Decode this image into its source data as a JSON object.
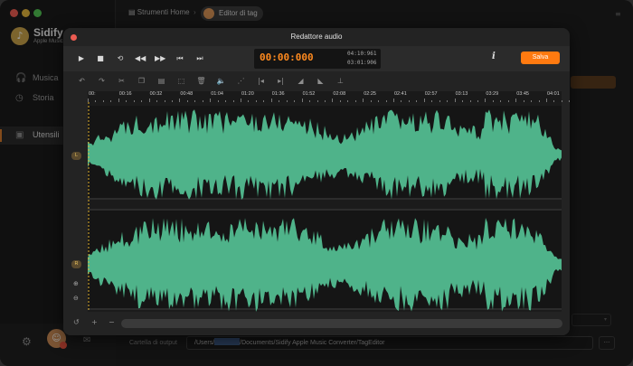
{
  "sidebar": {
    "brand_name": "Sidify",
    "brand_sub": "Apple Music Converter",
    "items": [
      {
        "label": "Musica",
        "icon": "headphones-icon"
      },
      {
        "label": "Storia",
        "icon": "clock-icon"
      },
      {
        "label": "Utensili",
        "icon": "toolbox-icon",
        "active": true
      }
    ]
  },
  "breadcrumb": {
    "home_label": "Strumenti Home",
    "current_label": "Editor di tag"
  },
  "output": {
    "label": "Cartella di output",
    "path_prefix": "/Users/",
    "path_suffix": "/Documents/Sidify Apple Music Converter/TagEditor",
    "more_label": "···"
  },
  "modal": {
    "title": "Redattore audio",
    "timecode": "00:00:000",
    "total_time": "04:10:961",
    "selection_time": "03:01:906",
    "save_label": "Salva",
    "info_label": "i"
  },
  "ruler_ticks": [
    "00:",
    "00:16",
    "00:32",
    "00:48",
    "01:04",
    "01:20",
    "01:36",
    "01:52",
    "02:08",
    "02:25",
    "02:41",
    "02:57",
    "03:13",
    "03:29",
    "03:45",
    "04:01"
  ],
  "channels": {
    "left": "L",
    "right": "R"
  },
  "colors": {
    "accent": "#ff7a10",
    "waveform": "#4fb38a",
    "timecode": "#ff8a1f",
    "playhead": "#e4b431"
  }
}
